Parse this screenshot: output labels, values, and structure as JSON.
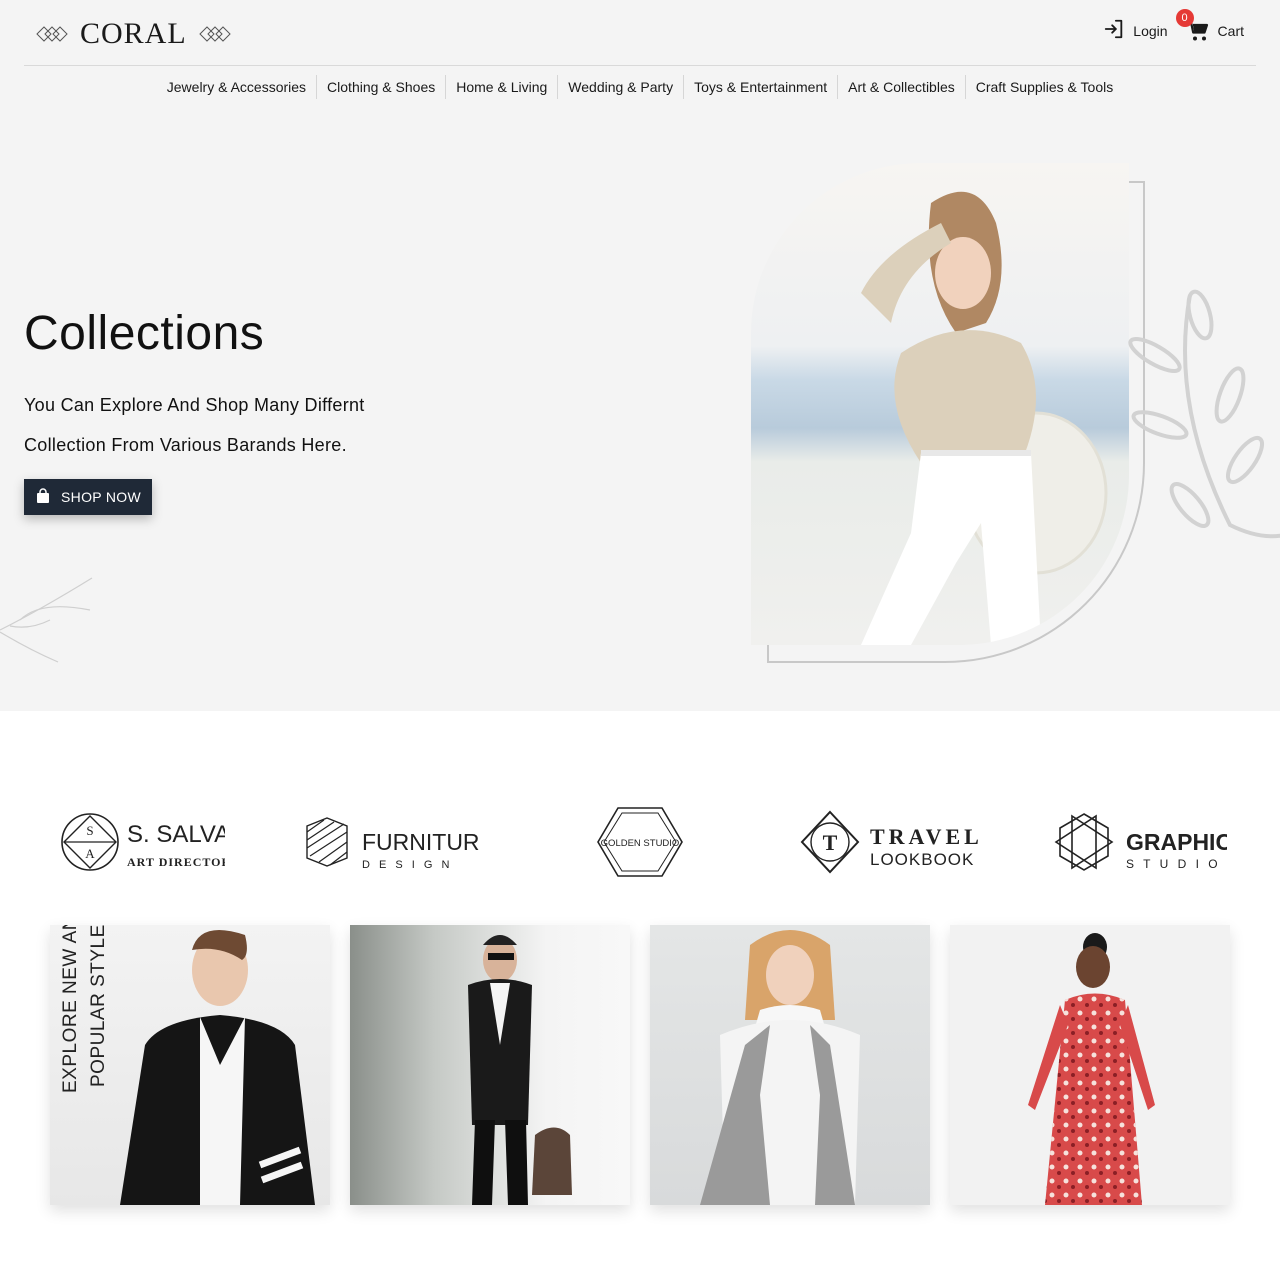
{
  "header": {
    "logo_text": "CORAL",
    "login_label": "Login",
    "cart_label": "Cart",
    "cart_count": "0"
  },
  "nav": {
    "categories": [
      "Jewelry & Accessories",
      "Clothing & Shoes",
      "Home & Living",
      "Wedding & Party",
      "Toys & Entertainment",
      "Art & Collectibles",
      "Craft Supplies & Tools"
    ]
  },
  "hero": {
    "title": "Collections",
    "subtitle_line1": "You Can Explore And Shop Many Differnt",
    "subtitle_line2": "Collection From Various Barands Here.",
    "button_label": "SHOP NOW"
  },
  "brands": [
    {
      "name": "S. SALVA",
      "tagline": "ART DIRECTOR",
      "mark1": "S",
      "mark2": "A"
    },
    {
      "name": "FURNITURE",
      "tagline": "D E S I G N"
    },
    {
      "name": "GOLDEN STUDIO"
    },
    {
      "name": "TRAVEL",
      "tagline": "LOOKBOOK",
      "mark1": "T"
    },
    {
      "name": "GRAPHIC",
      "tagline": "S T U D I O"
    }
  ],
  "cards": {
    "promo_line1": "EXPLORE NEW AND",
    "promo_line2": "POPULAR STYLES"
  },
  "colors": {
    "hero_bg": "#f4f4f4",
    "button_bg": "#1f2937",
    "badge": "#e53935"
  }
}
